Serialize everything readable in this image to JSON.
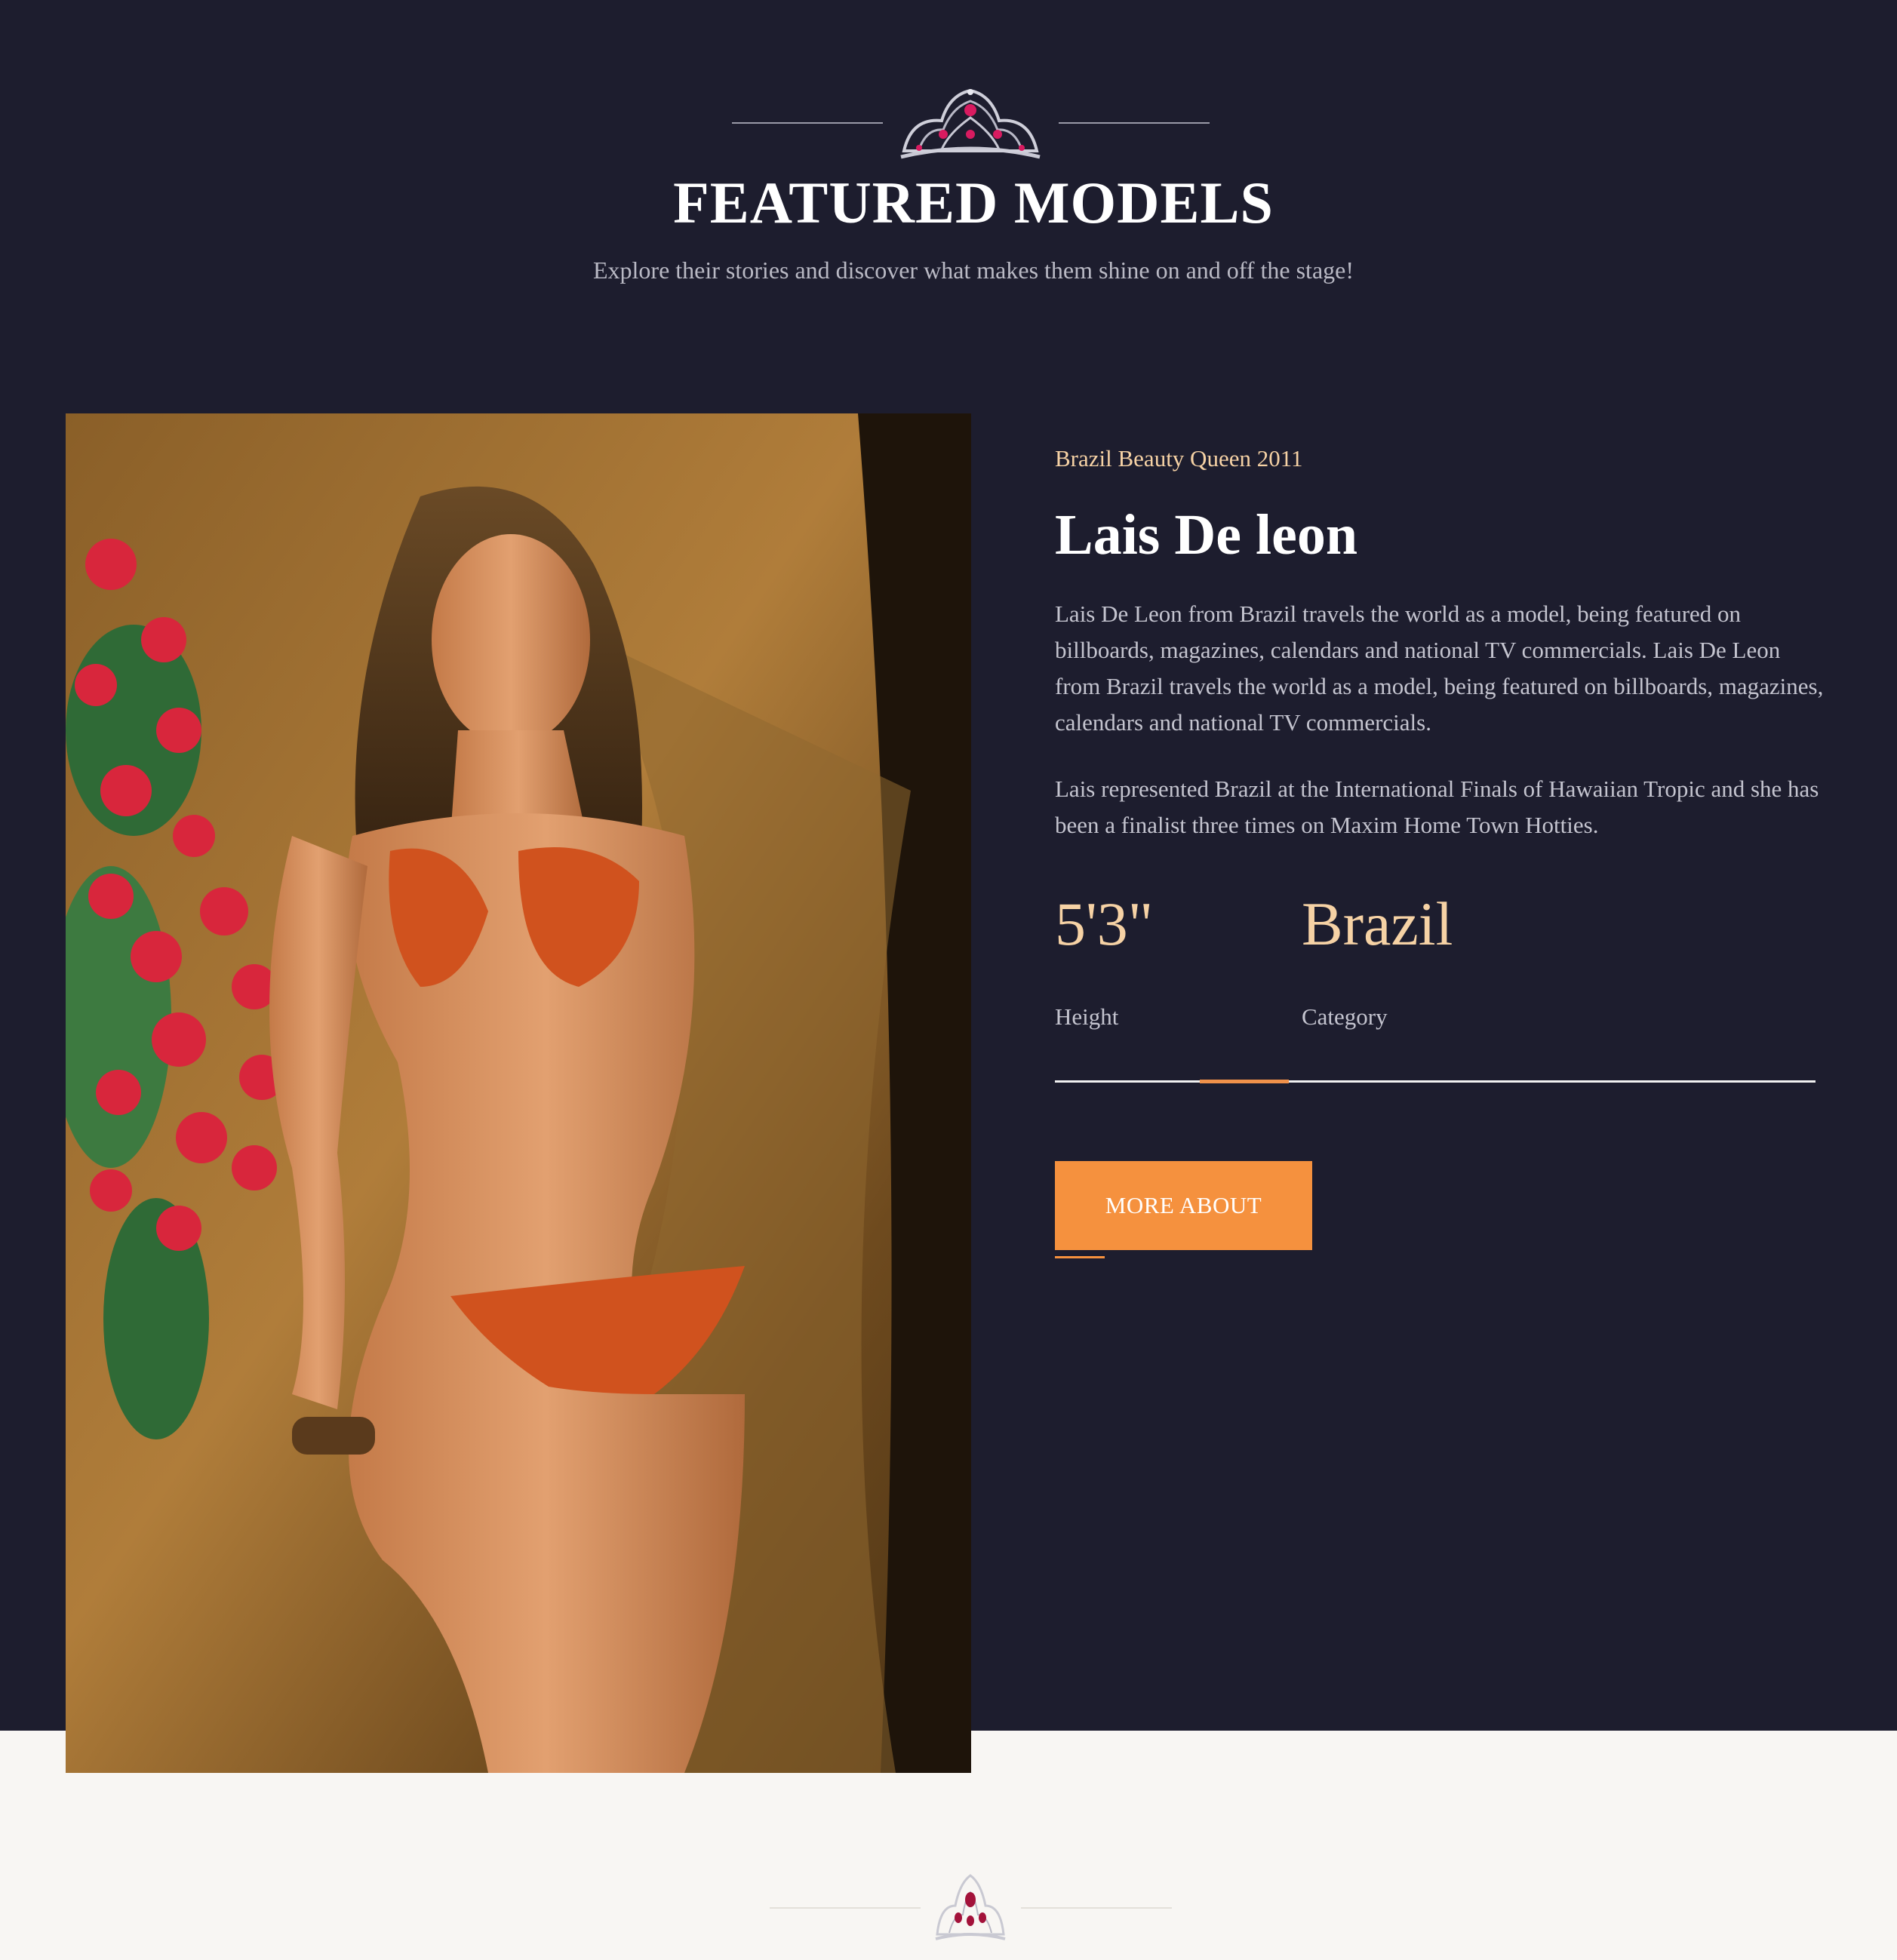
{
  "featured": {
    "title": "FEATURED MODELS",
    "subtitle": "Explore their stories and discover what makes them shine on and off the stage!",
    "crown_icon": "tiara-icon"
  },
  "model": {
    "tag": "Brazil Beauty Queen 2011",
    "name": "Lais De leon",
    "bio": [
      "Lais De Leon from Brazil travels the world as a model, being featured on billboards, magazines, calendars and national TV commercials. Lais De Leon from Brazil travels the world as a model, being featured on billboards, magazines, calendars and national TV commercials.",
      "Lais represented Brazil at the International Finals of Hawaiian Tropic and she has been a finalist three times on Maxim Home Town Hotties."
    ],
    "stats": [
      {
        "value": "5'3\"",
        "label": "Height"
      },
      {
        "value": "Brazil",
        "label": "Category"
      }
    ],
    "progress_fraction": 0.19,
    "button_label": "MORE ABOUT"
  },
  "colors": {
    "dark_background": "#1d1d2e",
    "accent_orange": "#f5913e",
    "accent_peach": "#f6d2a5",
    "light_background": "#f8f6f3"
  }
}
